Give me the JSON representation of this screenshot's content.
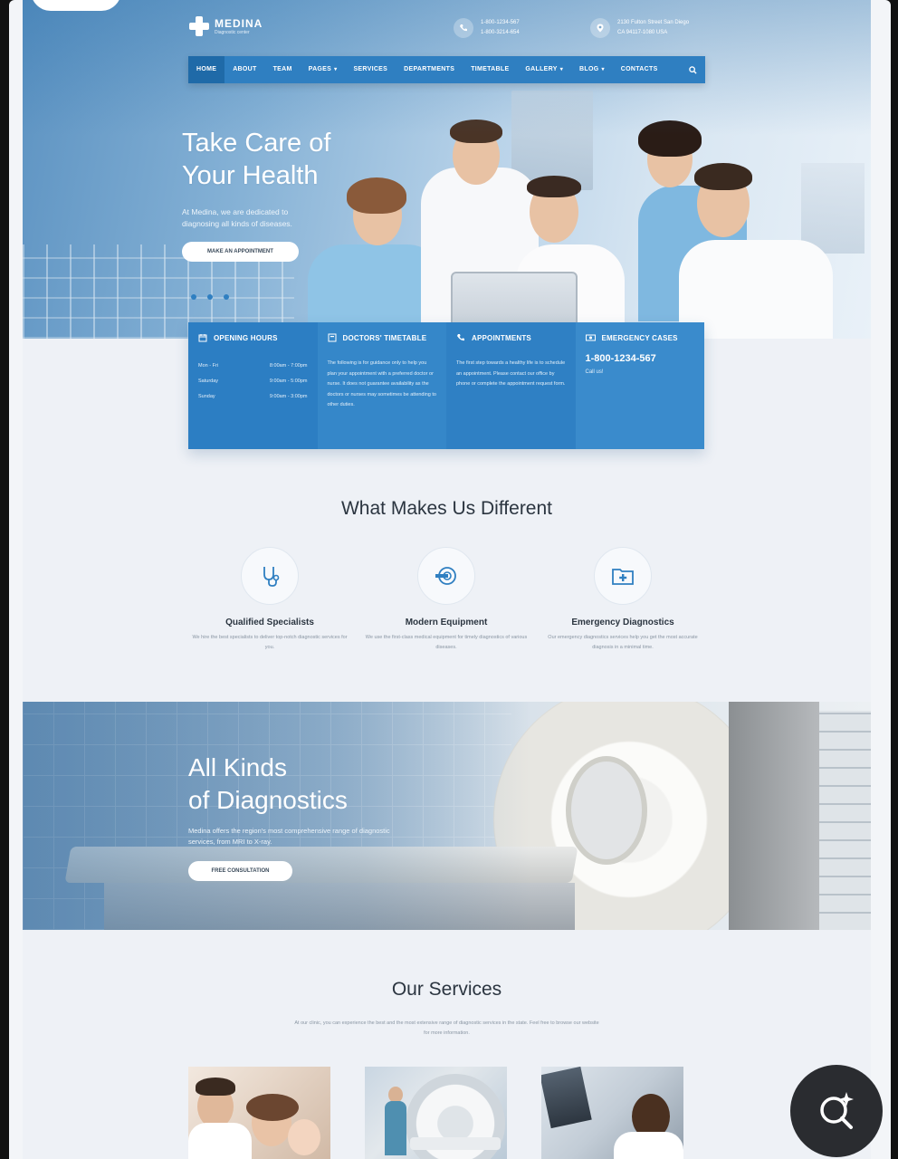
{
  "brand": {
    "name": "MEDINA",
    "tagline": "Diagnostic center"
  },
  "header": {
    "phones": [
      "1-800-1234-567",
      "1-800-3214-654"
    ],
    "address": [
      "2130 Fulton Street San Diego",
      "CA 94117-1080 USA"
    ]
  },
  "nav": {
    "items": [
      {
        "label": "HOME",
        "caret": ""
      },
      {
        "label": "ABOUT",
        "caret": ""
      },
      {
        "label": "TEAM",
        "caret": ""
      },
      {
        "label": "PAGES",
        "caret": "▾"
      },
      {
        "label": "SERVICES",
        "caret": ""
      },
      {
        "label": "DEPARTMENTS",
        "caret": ""
      },
      {
        "label": "TIMETABLE",
        "caret": ""
      },
      {
        "label": "GALLERY",
        "caret": "▾"
      },
      {
        "label": "BLOG",
        "caret": "▾"
      },
      {
        "label": "CONTACTS",
        "caret": ""
      }
    ]
  },
  "hero": {
    "title_line1": "Take Care of",
    "title_line2": "Your Health",
    "subtitle": "At Medina, we are dedicated to diagnosing all kinds of diseases.",
    "button": "MAKE AN APPOINTMENT"
  },
  "info": {
    "hours": {
      "title": "OPENING HOURS",
      "rows": [
        {
          "day": "Mon - Fri",
          "time": "8:00am - 7:00pm"
        },
        {
          "day": "Saturday",
          "time": "9:00am - 5:00pm"
        },
        {
          "day": "Sunday",
          "time": "9:00am - 3:00pm"
        }
      ]
    },
    "timetable": {
      "title": "DOCTORS' TIMETABLE",
      "text": "The following is for guidance only to help you plan your appointment with a preferred doctor or nurse. It does not guarantee availability as the doctors or nurses may sometimes be attending to other duties."
    },
    "appointments": {
      "title": "APPOINTMENTS",
      "text": "The first step towards a healthy life is to schedule an appointment. Please contact our office by phone or complete the appointment request form."
    },
    "emergency": {
      "title": "EMERGENCY CASES",
      "phone": "1-800-1234-567",
      "note": "Call us!"
    }
  },
  "different": {
    "title": "What Makes Us Different",
    "features": [
      {
        "icon": "stethoscope-icon",
        "title": "Qualified Specialists",
        "text": "We hire the best specialists to deliver top-notch diagnostic services for you."
      },
      {
        "icon": "scanner-icon",
        "title": "Modern Equipment",
        "text": "We use the first-class medical equipment for timely diagnostics of various diseases."
      },
      {
        "icon": "medical-folder-icon",
        "title": "Emergency Diagnostics",
        "text": "Our emergency diagnostics services help you get the most accurate diagnosis in a minimal time."
      }
    ]
  },
  "diagnostics": {
    "title_line1": "All Kinds",
    "title_line2": "of Diagnostics",
    "subtitle": "Medina offers the region's most comprehensive range of diagnostic services, from MRI to X-ray.",
    "button": "FREE CONSULTATION"
  },
  "services": {
    "title": "Our Services",
    "text": "At our clinic, you can experience the best and the most extensive range of diagnostic services in the state. Feel free to browse our website for more information."
  },
  "colors": {
    "primary": "#2f7fc1",
    "primary_dark": "#1f6aa8",
    "heading": "#2b3540",
    "muted": "#8a96a3"
  }
}
